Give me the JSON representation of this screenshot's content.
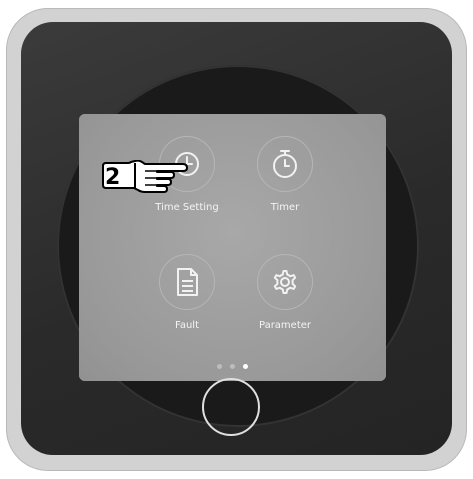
{
  "screen": {
    "menu_items": [
      {
        "label": "Time Setting",
        "icon": "clock-icon"
      },
      {
        "label": "Timer",
        "icon": "stopwatch-icon"
      },
      {
        "label": "Fault",
        "icon": "document-icon"
      },
      {
        "label": "Parameter",
        "icon": "gear-icon"
      }
    ],
    "pagination": {
      "total": 3,
      "active": 3
    }
  },
  "callout": {
    "step_number": "2",
    "icon": "pointing-hand-icon"
  },
  "colors": {
    "screen_bg": "#9c9c9c",
    "bezel": "#2e2e2e",
    "frame": "#d2d2d2",
    "icon_stroke": "#f2f2f2"
  }
}
